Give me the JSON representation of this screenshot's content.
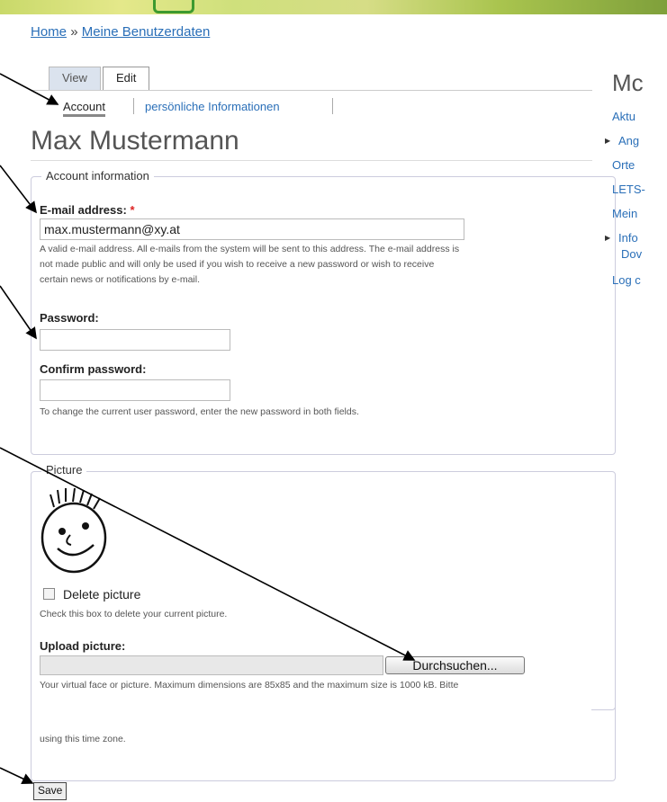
{
  "breadcrumb": {
    "home": "Home",
    "separator": "»",
    "current": "Meine Benutzerdaten"
  },
  "tabs": {
    "view": "View",
    "edit": "Edit"
  },
  "subtabs": {
    "account": "Account",
    "personal": "persönliche Informationen"
  },
  "page_title": "Max Mustermann",
  "account": {
    "legend": "Account information",
    "email_label": "E-mail address:",
    "required_mark": "*",
    "email_value": "max.mustermann@xy.at",
    "email_desc_1": "A valid e-mail address. All e-mails from the system will be sent to this address. The e-mail address is",
    "email_desc_2": "not made public and will only be used if you wish to receive a new password or wish to receive",
    "email_desc_3": "certain news or notifications by e-mail.",
    "password_label": "Password:",
    "confirm_label": "Confirm password:",
    "password_desc": "To change the current user password, enter the new password in both fields."
  },
  "picture": {
    "legend": "Picture",
    "delete_label": "Delete picture",
    "delete_desc": "Check this box to delete your current picture.",
    "upload_label": "Upload picture:",
    "browse_button": "Durchsuchen...",
    "upload_desc": "Your virtual face or picture. Maximum dimensions are 85x85 and the maximum size is 1000 kB. Bitte"
  },
  "timezone": {
    "desc_tail": "using this time zone."
  },
  "save_button": "Save",
  "sidebar": {
    "title": "Mc",
    "items": [
      "Aktu",
      "Ang",
      "Orte",
      "LETS-",
      "Mein",
      "Info",
      "Dov",
      "Log c"
    ]
  }
}
